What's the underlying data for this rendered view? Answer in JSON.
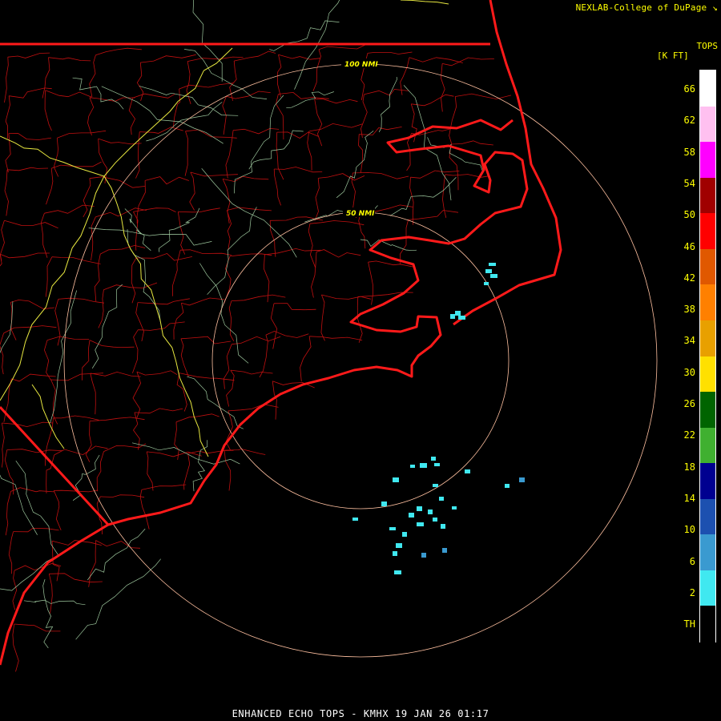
{
  "credit": "NEXLAB-College of DuPage",
  "credit_icon": "arrow-cursor-icon",
  "legend": {
    "title_line1": "TOPS",
    "title_line2": "[K FT]",
    "colors": [
      "#ffffff",
      "#ffc0f0",
      "#ff00ff",
      "#a00000",
      "#ff0000",
      "#e05800",
      "#ff8000",
      "#e8a000",
      "#ffe000",
      "#006400",
      "#40b030",
      "#000090",
      "#1c50b0",
      "#3a9ad0",
      "#40e8f0",
      "#000000"
    ],
    "labels": [
      "66",
      "62",
      "58",
      "54",
      "50",
      "46",
      "42",
      "38",
      "34",
      "30",
      "26",
      "22",
      "18",
      "14",
      "10",
      "6",
      "2",
      "TH"
    ]
  },
  "range_rings": [
    {
      "label": "100 NMI"
    },
    {
      "label": "50 NMI"
    }
  ],
  "footer": "ENHANCED ECHO TOPS - KMHX 19 JAN 26 01:17",
  "colors": {
    "state_border": "#ff1a1a",
    "county_line": "#c01010",
    "road": "#9ec89e",
    "interstate": "#e8e840",
    "ring": "#ffc0a0",
    "echo_low": "#40e8f0",
    "echo_mid": "#3a9ad0"
  }
}
